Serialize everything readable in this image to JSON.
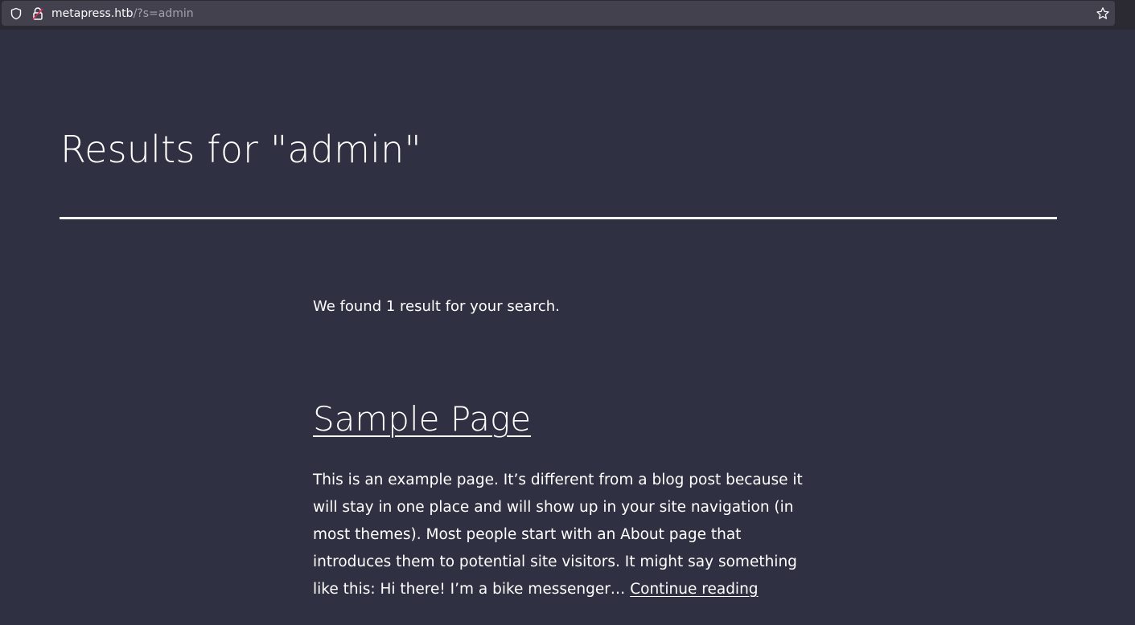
{
  "browser": {
    "url_host": "metapress.htb",
    "url_path": "/?s=admin",
    "icons": {
      "shield": "shield-icon",
      "lock": "lock-icon",
      "bookmark": "star-icon"
    }
  },
  "page": {
    "title": "Results for \"admin\"",
    "result_count": "We found 1 result for your search."
  },
  "results": [
    {
      "title": "Sample Page",
      "excerpt": "This is an example page. It’s different from a blog post because it will stay in one place and will show up in your site navigation (in most themes). Most people start with an About page that introduces them to potential site visitors. It might say something like this: Hi there! I’m a bike messenger… ",
      "continue_label": "Continue reading"
    }
  ],
  "colors": {
    "background": "#2f3041",
    "toolbar": "#2b2a33",
    "url_field": "#42414d",
    "text": "#ffffff",
    "lock_accent": "#e22850"
  }
}
